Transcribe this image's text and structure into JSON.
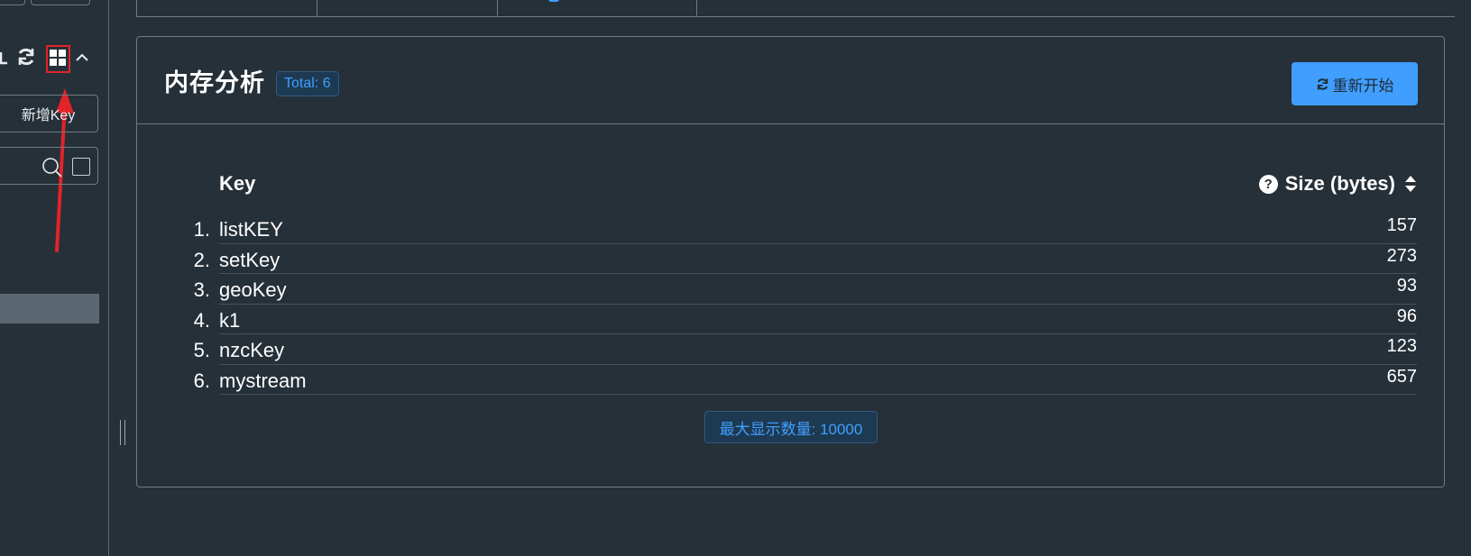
{
  "sidebar": {
    "add_key_label": "新增Key",
    "icons": [
      "refresh-icon",
      "grid-icon",
      "chevron-up-icon",
      "search-icon"
    ]
  },
  "panel": {
    "title": "内存分析",
    "total_badge": "Total: 6",
    "restart_label": "重新开始",
    "table": {
      "col_key": "Key",
      "col_size": "Size (bytes)",
      "rows": [
        {
          "index": "1.",
          "key": "listKEY",
          "size": "157"
        },
        {
          "index": "2.",
          "key": "setKey",
          "size": "273"
        },
        {
          "index": "3.",
          "key": "geoKey",
          "size": "93"
        },
        {
          "index": "4.",
          "key": "k1",
          "size": "96"
        },
        {
          "index": "5.",
          "key": "nzcKey",
          "size": "123"
        },
        {
          "index": "6.",
          "key": "mystream",
          "size": "657"
        }
      ]
    },
    "max_display_label": "最大显示数量: 10000"
  },
  "colors": {
    "background": "#263038",
    "accent": "#409eff",
    "annotation_red": "#e2232a",
    "border": "#6e7a84"
  }
}
